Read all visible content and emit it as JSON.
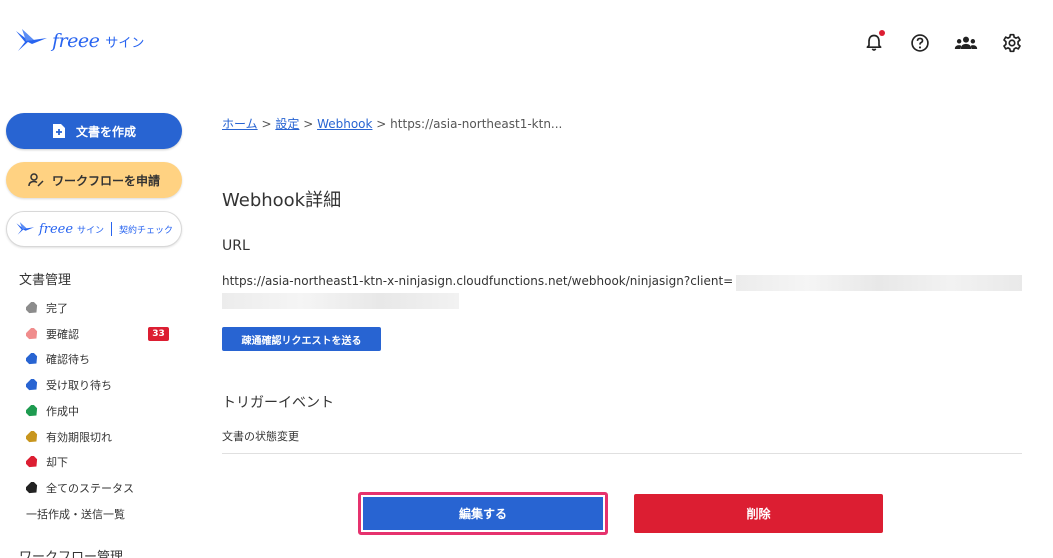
{
  "header": {
    "logo_brand": "freee",
    "logo_sub": "サイン",
    "icons": [
      "bell-icon",
      "help-icon",
      "team-icon",
      "gear-icon"
    ],
    "notification_dot_color": "#dc1e32"
  },
  "sidebar": {
    "create_doc_label": "文書を作成",
    "workflow_label": "ワークフローを申請",
    "check_brand": "freee",
    "check_sub": "サイン",
    "check_label": "契約チェック",
    "doc_management_title": "文書管理",
    "items": [
      {
        "label": "完了",
        "color": "#8c8c8c"
      },
      {
        "label": "要確認",
        "color": "#f08c8c",
        "badge": "33"
      },
      {
        "label": "確認待ち",
        "color": "#2864d2"
      },
      {
        "label": "受け取り待ち",
        "color": "#2864d2"
      },
      {
        "label": "作成中",
        "color": "#1e9b50"
      },
      {
        "label": "有効期限切れ",
        "color": "#c8961e"
      },
      {
        "label": "却下",
        "color": "#dc1e32"
      },
      {
        "label": "全てのステータス",
        "color": "#222222"
      }
    ],
    "bulk_label": "一括作成・送信一覧",
    "workflow_title": "ワークフロー管理"
  },
  "breadcrumb": {
    "home": "ホーム",
    "settings": "設定",
    "webhook": "Webhook",
    "current": "https://asia-northeast1-ktn..."
  },
  "main": {
    "title": "Webhook詳細",
    "url_label": "URL",
    "url_value": "https://asia-northeast1-ktn-x-ninjasign.cloudfunctions.net/webhook/ninjasign?client=",
    "test_button": "疎通確認リクエストを送る",
    "trigger_label": "トリガーイベント",
    "trigger_value": "文書の状態変更",
    "edit_button": "編集する",
    "delete_button": "削除"
  },
  "colors": {
    "primary": "#2864d2",
    "danger": "#dc1e32",
    "highlight": "#e6326e",
    "workflow": "#ffd282"
  }
}
